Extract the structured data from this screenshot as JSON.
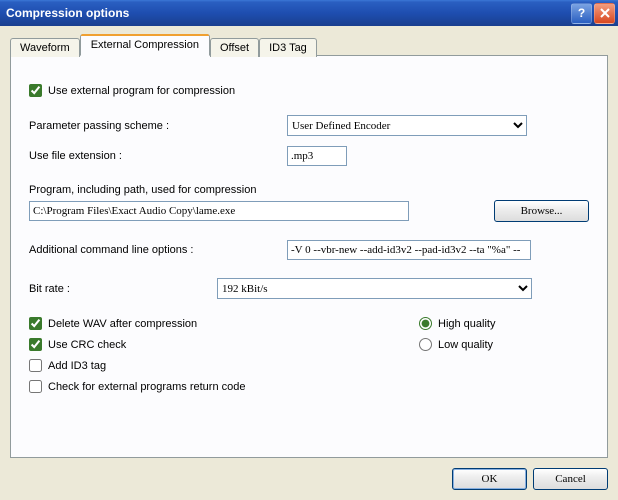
{
  "window": {
    "title": "Compression options"
  },
  "tabs": {
    "waveform": "Waveform",
    "external": "External Compression",
    "offset": "Offset",
    "id3": "ID3 Tag"
  },
  "panel": {
    "use_external": "Use external program for compression",
    "param_scheme_label": "Parameter passing scheme :",
    "param_scheme_value": "User Defined Encoder",
    "file_ext_label": "Use file extension :",
    "file_ext_value": ".mp3",
    "program_label": "Program, including path, used for compression",
    "program_value": "C:\\Program Files\\Exact Audio Copy\\lame.exe",
    "browse": "Browse...",
    "addl_label": "Additional command line options :",
    "addl_value": "-V 0 --vbr-new --add-id3v2 --pad-id3v2 --ta \"%a\" --",
    "bitrate_label": "Bit rate :",
    "bitrate_value": "192 kBit/s",
    "delete_wav": "Delete WAV after compression",
    "use_crc": "Use CRC check",
    "add_id3": "Add ID3 tag",
    "check_return": "Check for external programs return code",
    "high_quality": "High quality",
    "low_quality": "Low quality"
  },
  "buttons": {
    "ok": "OK",
    "cancel": "Cancel"
  }
}
